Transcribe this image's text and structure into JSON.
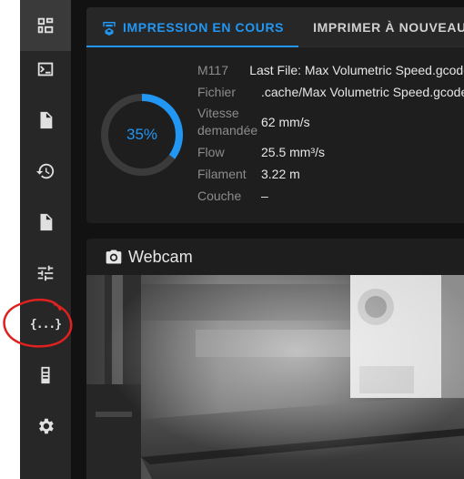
{
  "sidebar": {
    "items": [
      {
        "name": "dashboard",
        "icon": "dashboard-icon",
        "active": true
      },
      {
        "name": "console",
        "icon": "console-icon"
      },
      {
        "name": "files",
        "icon": "file-list-icon"
      },
      {
        "name": "history",
        "icon": "history-icon"
      },
      {
        "name": "timelapse",
        "icon": "video-file-icon"
      },
      {
        "name": "tune",
        "icon": "tune-icon"
      },
      {
        "name": "macros",
        "icon": "code-braces-icon",
        "glyph": "{...}"
      },
      {
        "name": "machine",
        "icon": "server-icon"
      },
      {
        "name": "settings",
        "icon": "gear-icon"
      }
    ]
  },
  "print_card": {
    "tab_active": "IMPRESSION EN COURS",
    "tab_other": "IMPRIMER À NOUVEAU",
    "progress": {
      "value": 0.35,
      "label": "35%"
    },
    "rows": [
      {
        "key": "M117",
        "value": "Last File: Max Volumetric Speed.gcode"
      },
      {
        "key": "Fichier",
        "value": ".cache/Max Volumetric Speed.gcode"
      },
      {
        "key": "Vitesse\ndemandée",
        "value": "62 mm/s"
      },
      {
        "key": "Flow",
        "value": "25.5 mm³/s"
      },
      {
        "key": "Filament",
        "value": "3.22 m"
      },
      {
        "key": "Couche",
        "value": "–"
      }
    ]
  },
  "webcam_card": {
    "title": "Webcam"
  },
  "colors": {
    "accent": "#2196f3",
    "annotation": "#e0211f",
    "sidebar_bg": "#272727",
    "card_bg": "#1e1e1e"
  }
}
